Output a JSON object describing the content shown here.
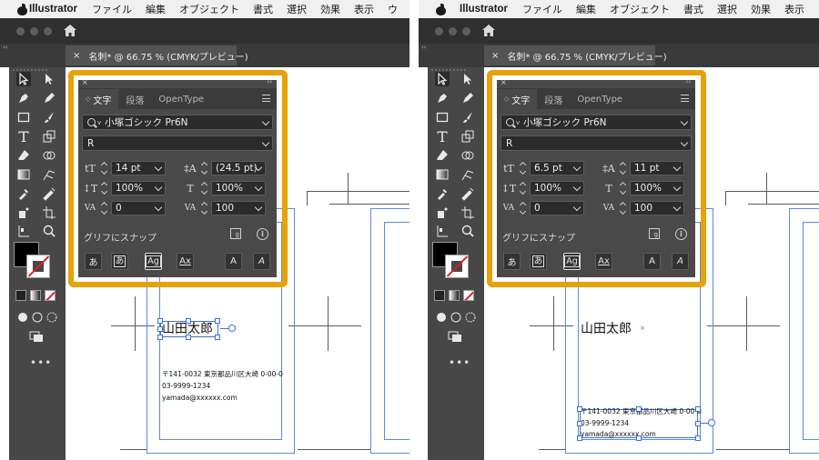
{
  "menubar": {
    "app": "Illustrator",
    "items_left": [
      "ファイル",
      "編集",
      "オブジェクト",
      "書式",
      "選択",
      "効果",
      "表示",
      "ウ"
    ],
    "items_right": [
      "ファイル",
      "編集",
      "オブジェクト",
      "書式",
      "選択",
      "効果",
      "表示"
    ]
  },
  "document_tab": {
    "title": "名刺* @ 66.75 % (CMYK/プレビュー)",
    "close": "×"
  },
  "panel_tabs": [
    "文字",
    "段落",
    "OpenType"
  ],
  "panel_close": "×",
  "panel_collapse": "‹‹",
  "card": {
    "name": "山田太郎",
    "address": "〒141-0032 東京都品川区大崎 0-00-0",
    "phone": "03-9999-1234",
    "email": "yamada@xxxxxx.com"
  },
  "left": {
    "font_family": "小塚ゴシック Pr6N",
    "font_style": "R",
    "font_size": "14 pt",
    "leading": "(24.5 pt)",
    "vertical_scale": "100%",
    "horizontal_scale": "100%",
    "kerning": "0",
    "tracking": "100"
  },
  "right": {
    "font_family": "小塚ゴシック Pr6N",
    "font_style": "R",
    "font_size": "6.5 pt",
    "leading": "11 pt",
    "vertical_scale": "100%",
    "horizontal_scale": "100%",
    "kerning": "0",
    "tracking": "100"
  },
  "snap": {
    "label": "グリフにスナップ",
    "buttons": [
      "あ",
      "あ",
      "Ag",
      "Ax",
      "A",
      "A"
    ],
    "info": "i"
  },
  "colors": {
    "highlight": "#e5a209",
    "panel_bg": "#494949",
    "guide_blue": "#5a8ae6"
  },
  "icons": [
    "apple-icon",
    "home-icon",
    "search-icon",
    "chevron-down-icon",
    "hamburger-menu-icon",
    "info-icon"
  ]
}
